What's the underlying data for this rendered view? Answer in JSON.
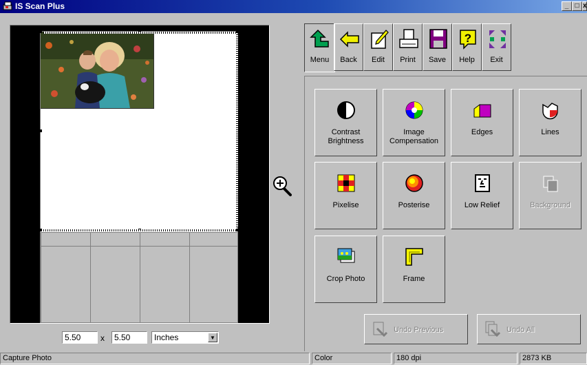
{
  "window": {
    "title": "IS Scan Plus"
  },
  "size_controls": {
    "width": "5.50",
    "separator": "x",
    "height": "5.50",
    "units": "Inches"
  },
  "toolbar": [
    {
      "name": "menu",
      "label": "Menu"
    },
    {
      "name": "back",
      "label": "Back"
    },
    {
      "name": "edit",
      "label": "Edit"
    },
    {
      "name": "print",
      "label": "Print"
    },
    {
      "name": "save",
      "label": "Save"
    },
    {
      "name": "help",
      "label": "Help"
    },
    {
      "name": "exit",
      "label": "Exit"
    }
  ],
  "functions": [
    {
      "name": "contrast-brightness",
      "label": "Contrast\nBrightness",
      "enabled": true,
      "icon": "half-circle-icon"
    },
    {
      "name": "image-compensation",
      "label": "Image\nCompensation",
      "enabled": true,
      "icon": "color-wheel-icon"
    },
    {
      "name": "edges",
      "label": "Edges",
      "enabled": true,
      "icon": "edges-icon"
    },
    {
      "name": "lines",
      "label": "Lines",
      "enabled": true,
      "icon": "lines-icon"
    },
    {
      "name": "pixelise",
      "label": "Pixelise",
      "enabled": true,
      "icon": "pixel-grid-icon"
    },
    {
      "name": "posterise",
      "label": "Posterise",
      "enabled": true,
      "icon": "posterise-icon"
    },
    {
      "name": "low-relief",
      "label": "Low Relief",
      "enabled": true,
      "icon": "relief-face-icon"
    },
    {
      "name": "background",
      "label": "Background",
      "enabled": false,
      "icon": "background-icon"
    },
    {
      "name": "crop-photo",
      "label": "Crop Photo",
      "enabled": true,
      "icon": "crop-photo-icon"
    },
    {
      "name": "frame",
      "label": "Frame",
      "enabled": true,
      "icon": "frame-icon"
    }
  ],
  "undo": {
    "previous": "Undo Previous",
    "all": "Undo All"
  },
  "status": {
    "left": "Capture Photo",
    "mode": "Color",
    "resolution": "180 dpi",
    "memory": "2873 KB"
  },
  "colors": {
    "titlebar_start": "#000080",
    "face": "#c0c0c0",
    "menu_arrow": "#00a050",
    "back_arrow": "#f0f000"
  }
}
